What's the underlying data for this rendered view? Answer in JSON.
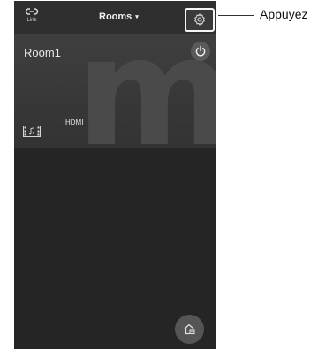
{
  "header": {
    "link_label": "Link",
    "rooms_label": "Rooms",
    "rooms_caret": "▾",
    "link_icon": "link-icon",
    "settings_icon": "gear-icon"
  },
  "room": {
    "name": "Room1",
    "watermark_glyph": "m",
    "source_label": "HDMI",
    "power_icon": "power-icon",
    "source_icon": "film-music-icon"
  },
  "fab": {
    "icon": "room-add-icon"
  },
  "annotation": {
    "label": "Appuyez"
  },
  "colors": {
    "app_background": "#252525",
    "header_background": "#2f2f2f",
    "highlight_border": "#f4f4f4"
  }
}
